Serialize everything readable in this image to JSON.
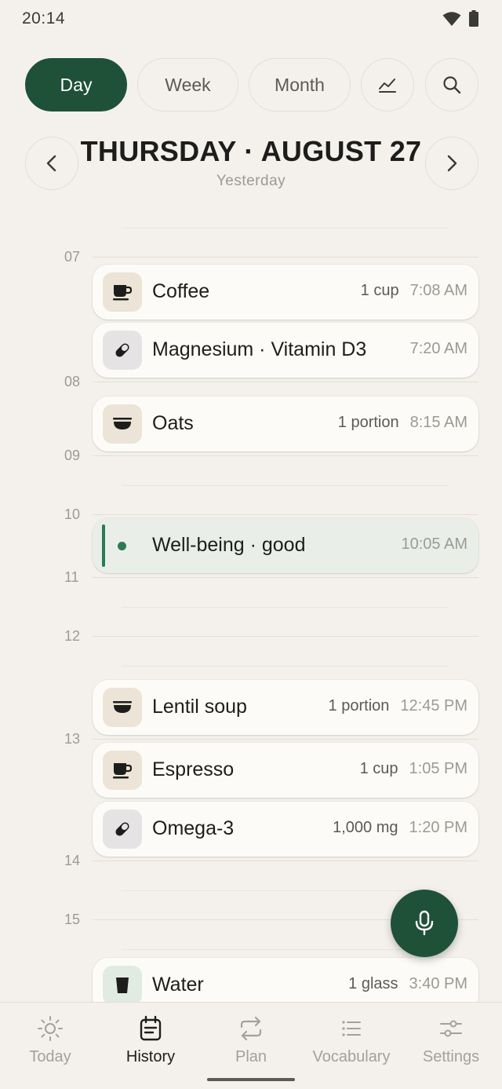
{
  "status_bar": {
    "time": "20:14"
  },
  "view_tabs": {
    "day": "Day",
    "week": "Week",
    "month": "Month"
  },
  "header": {
    "date": "THURSDAY · AUGUST 27",
    "relative": "Yesterday"
  },
  "hours": [
    "07",
    "08",
    "09",
    "10",
    "11",
    "12",
    "13",
    "14",
    "15"
  ],
  "entries": [
    {
      "name": "Coffee",
      "quantity": "1 cup",
      "time": "7:08 AM",
      "icon": "coffee-cup-icon"
    },
    {
      "name": "Magnesium · Vitamin D3",
      "quantity": "",
      "time": "7:20 AM",
      "icon": "pill-icon"
    },
    {
      "name": "Oats",
      "quantity": "1 portion",
      "time": "8:15 AM",
      "icon": "bowl-icon"
    },
    {
      "name": "Well-being · good",
      "quantity": "",
      "time": "10:05 AM",
      "icon": "mood-dot"
    },
    {
      "name": "Lentil soup",
      "quantity": "1 portion",
      "time": "12:45 PM",
      "icon": "bowl-icon"
    },
    {
      "name": "Espresso",
      "quantity": "1 cup",
      "time": "1:05 PM",
      "icon": "coffee-cup-icon"
    },
    {
      "name": "Omega-3",
      "quantity": "1,000 mg",
      "time": "1:20 PM",
      "icon": "pill-icon"
    },
    {
      "name": "Water",
      "quantity": "1 glass",
      "time": "3:40 PM",
      "icon": "glass-icon"
    }
  ],
  "bottom_nav": {
    "today": "Today",
    "history": "History",
    "plan": "Plan",
    "vocabulary": "Vocabulary",
    "settings": "Settings",
    "active": "History"
  },
  "colors": {
    "accent": "#1f5138",
    "mood": "#2f7a53",
    "background": "#f4f1ec"
  }
}
